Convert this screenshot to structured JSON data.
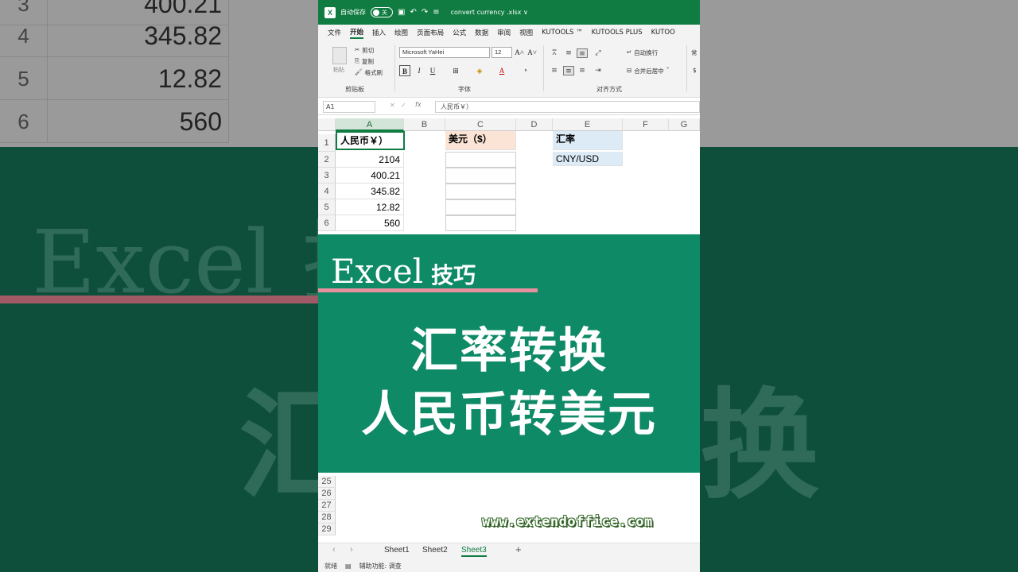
{
  "background": {
    "rows": [
      {
        "num": "3",
        "value": "400.21"
      },
      {
        "num": "4",
        "value": "345.82"
      },
      {
        "num": "5",
        "value": "12.82"
      },
      {
        "num": "6",
        "value": "560"
      }
    ],
    "big_line1": "Excel 技",
    "big_line2": "汇",
    "big_line3": "换"
  },
  "titlebar": {
    "logo": "X",
    "autosave_label": "自动保存",
    "autosave_state": "关",
    "filename": "convert currency .xlsx ∨"
  },
  "ribbon_tabs": [
    "文件",
    "开始",
    "插入",
    "绘图",
    "页面布局",
    "公式",
    "数据",
    "审阅",
    "视图",
    "KUTOOLS ™",
    "KUTOOLS PLUS",
    "KUTOO"
  ],
  "ribbon_active_tab": "开始",
  "ribbon": {
    "paste_label": "粘贴",
    "cut": "剪切",
    "copy": "复制",
    "format_painter": "格式刷",
    "clipboard_group": "剪贴板",
    "font_name": "Microsoft YaHei",
    "font_size": "12",
    "font_group": "字体",
    "wrap_text": "自动换行",
    "merge_center": "合并后居中",
    "align_group": "对齐方式",
    "number_hint": "常",
    "currency_hint": "$"
  },
  "formula_bar": {
    "name_box": "A1",
    "fx": "fx",
    "content": "人民币￥）"
  },
  "columns": [
    "A",
    "B",
    "C",
    "D",
    "E",
    "F",
    "G"
  ],
  "row_numbers": [
    "1",
    "2",
    "3",
    "4",
    "5",
    "6"
  ],
  "cells": {
    "A1": "人民币￥）",
    "C1": "美元（$）",
    "E1": "汇率",
    "E2": "CNY/USD",
    "A_values": [
      "2104",
      "400.21",
      "345.82",
      "12.82",
      "560"
    ]
  },
  "overlay": {
    "excel": "Excel",
    "tips": "技巧",
    "line1": "汇率转换",
    "line2": "人民币转美元"
  },
  "lower_rows": [
    "25",
    "26",
    "27",
    "28",
    "29"
  ],
  "watermark": "www.extendoffice.com",
  "sheets": [
    "Sheet1",
    "Sheet2",
    "Sheet3"
  ],
  "active_sheet": "Sheet3",
  "add_sheet": "+",
  "status": {
    "ready": "就绪",
    "accessibility": "辅助功能: 调查"
  },
  "colors": {
    "excel_green": "#107c41",
    "overlay_green": "#0e8a67",
    "accent_pink": "#e8909d"
  }
}
